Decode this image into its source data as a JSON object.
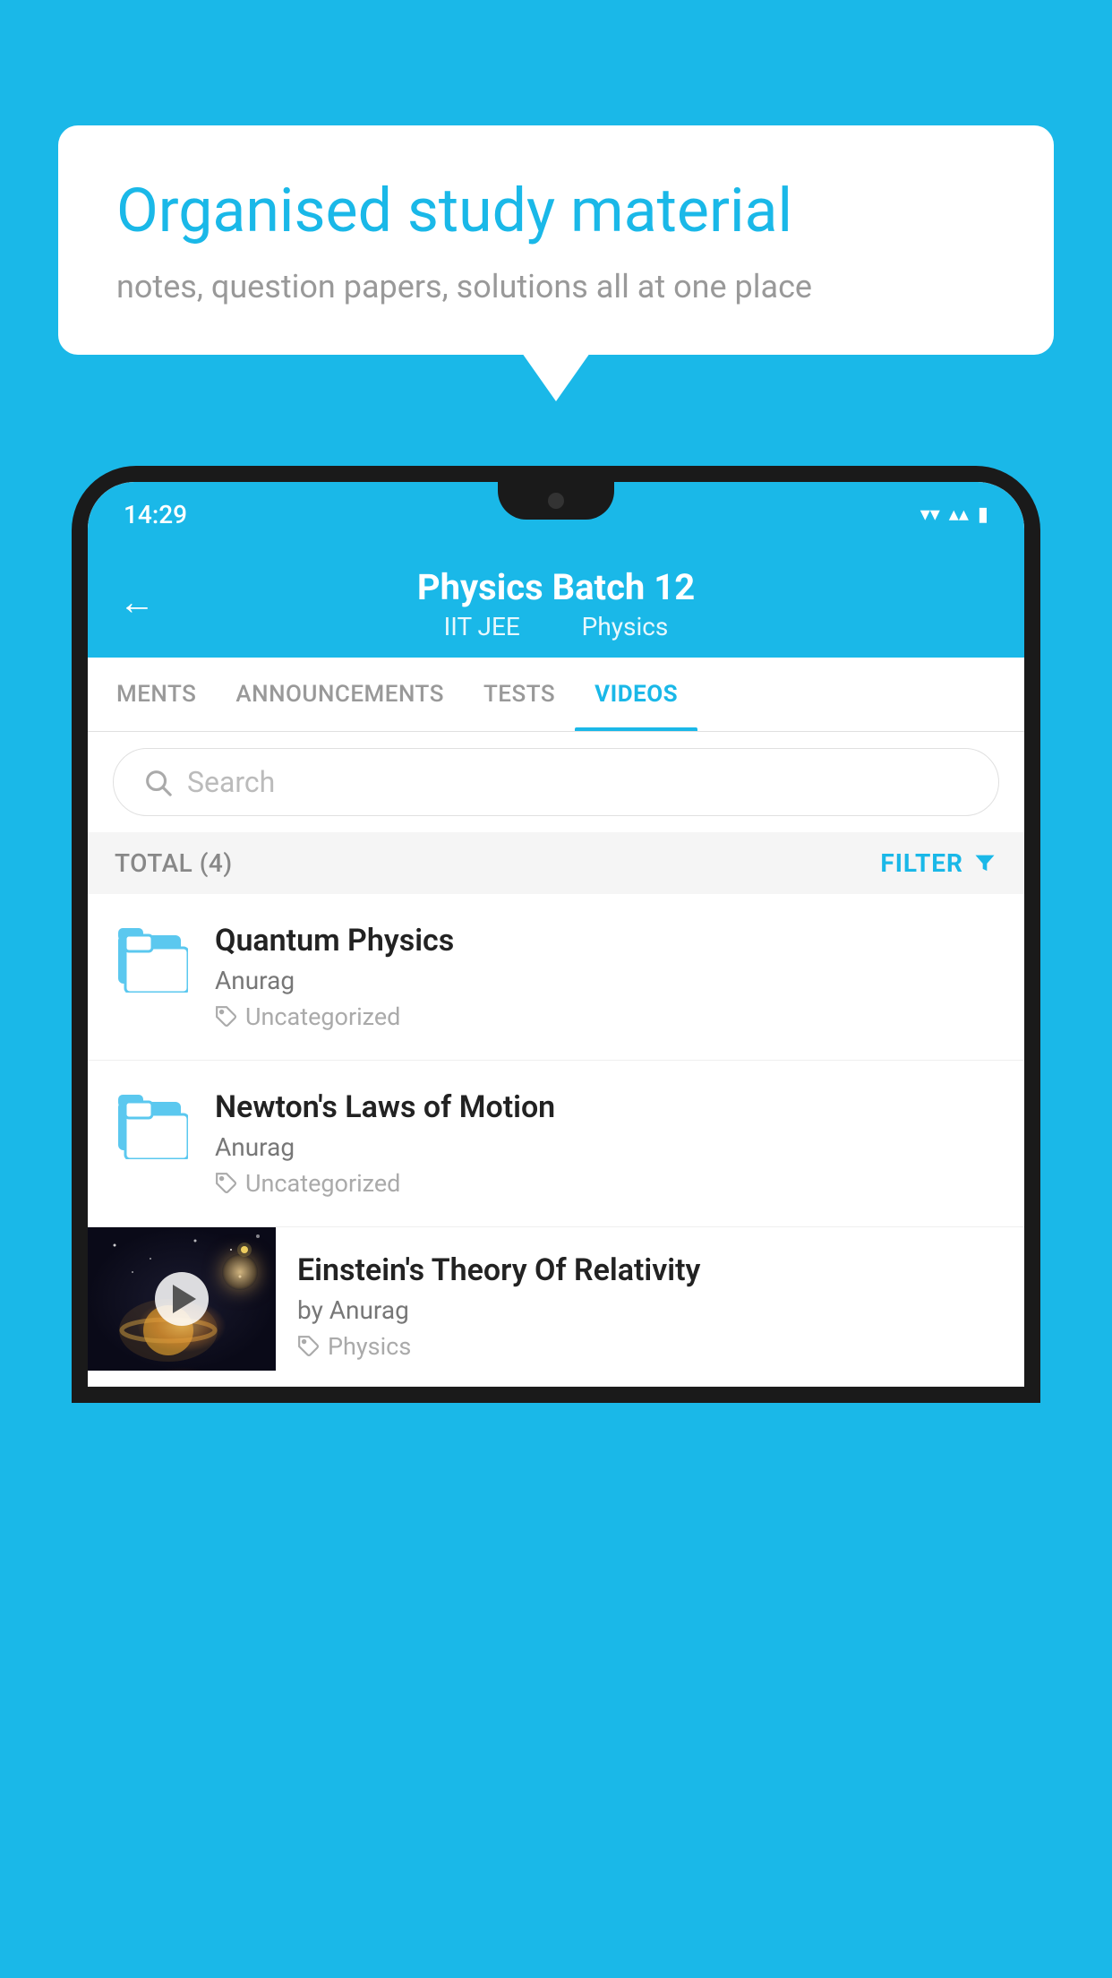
{
  "background_color": "#1ab8e8",
  "bubble": {
    "title": "Organised study material",
    "subtitle": "notes, question papers, solutions all at one place"
  },
  "status_bar": {
    "time": "14:29",
    "wifi": "▾",
    "signal": "▴",
    "battery": "▮"
  },
  "app_header": {
    "back_label": "←",
    "title": "Physics Batch 12",
    "tag1": "IIT JEE",
    "tag2": "Physics"
  },
  "tabs": [
    {
      "label": "MENTS",
      "active": false
    },
    {
      "label": "ANNOUNCEMENTS",
      "active": false
    },
    {
      "label": "TESTS",
      "active": false
    },
    {
      "label": "VIDEOS",
      "active": true
    }
  ],
  "search": {
    "placeholder": "Search"
  },
  "filter_bar": {
    "total_label": "TOTAL (4)",
    "filter_label": "FILTER"
  },
  "videos": [
    {
      "title": "Quantum Physics",
      "author": "Anurag",
      "tag": "Uncategorized",
      "has_thumb": false
    },
    {
      "title": "Newton's Laws of Motion",
      "author": "Anurag",
      "tag": "Uncategorized",
      "has_thumb": false
    },
    {
      "title": "Einstein's Theory Of Relativity",
      "author": "by Anurag",
      "tag": "Physics",
      "has_thumb": true
    }
  ]
}
